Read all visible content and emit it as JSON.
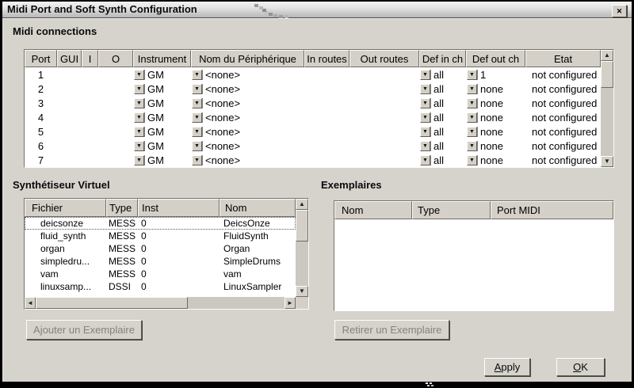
{
  "window": {
    "title": "Midi Port and Soft Synth Configuration"
  },
  "icons": {
    "close": "✕",
    "combo_arrow": "▼",
    "scroll_up": "▲",
    "scroll_down": "▼",
    "scroll_left": "◄",
    "scroll_right": "►"
  },
  "midi": {
    "label": "Midi connections",
    "columns": [
      "Port",
      "GUI",
      "I",
      "O",
      "Instrument",
      "Nom du Périphérique",
      "In routes",
      "Out routes",
      "Def in ch",
      "Def out ch",
      "Etat"
    ],
    "rows": [
      {
        "port": "1",
        "instrument": "GM",
        "device": "<none>",
        "def_in": "all",
        "def_out": "1",
        "etat": "not configured"
      },
      {
        "port": "2",
        "instrument": "GM",
        "device": "<none>",
        "def_in": "all",
        "def_out": "none",
        "etat": "not configured"
      },
      {
        "port": "3",
        "instrument": "GM",
        "device": "<none>",
        "def_in": "all",
        "def_out": "none",
        "etat": "not configured"
      },
      {
        "port": "4",
        "instrument": "GM",
        "device": "<none>",
        "def_in": "all",
        "def_out": "none",
        "etat": "not configured"
      },
      {
        "port": "5",
        "instrument": "GM",
        "device": "<none>",
        "def_in": "all",
        "def_out": "none",
        "etat": "not configured"
      },
      {
        "port": "6",
        "instrument": "GM",
        "device": "<none>",
        "def_in": "all",
        "def_out": "none",
        "etat": "not configured"
      },
      {
        "port": "7",
        "instrument": "GM",
        "device": "<none>",
        "def_in": "all",
        "def_out": "none",
        "etat": "not configured"
      }
    ]
  },
  "synth": {
    "label": "Synthétiseur Virtuel",
    "columns": [
      "Fichier",
      "Type",
      "Inst",
      "Nom"
    ],
    "rows": [
      {
        "fichier": "deicsonze",
        "type": "MESS",
        "inst": "0",
        "nom": "DeicsOnze"
      },
      {
        "fichier": "fluid_synth",
        "type": "MESS",
        "inst": "0",
        "nom": "FluidSynth"
      },
      {
        "fichier": "organ",
        "type": "MESS",
        "inst": "0",
        "nom": "Organ"
      },
      {
        "fichier": "simpledru...",
        "type": "MESS",
        "inst": "0",
        "nom": "SimpleDrums"
      },
      {
        "fichier": "vam",
        "type": "MESS",
        "inst": "0",
        "nom": "vam"
      },
      {
        "fichier": "linuxsamp...",
        "type": "DSSI",
        "inst": "0",
        "nom": "LinuxSampler"
      }
    ],
    "add_button": "Ajouter un Exemplaire"
  },
  "instances": {
    "label": "Exemplaires",
    "columns": [
      "Nom",
      "Type",
      "Port MIDI"
    ],
    "remove_button": "Retirer un Exemplaire"
  },
  "footer": {
    "apply": {
      "mnemonic": "A",
      "rest": "pply"
    },
    "ok": {
      "mnemonic": "O",
      "rest": "K"
    }
  }
}
